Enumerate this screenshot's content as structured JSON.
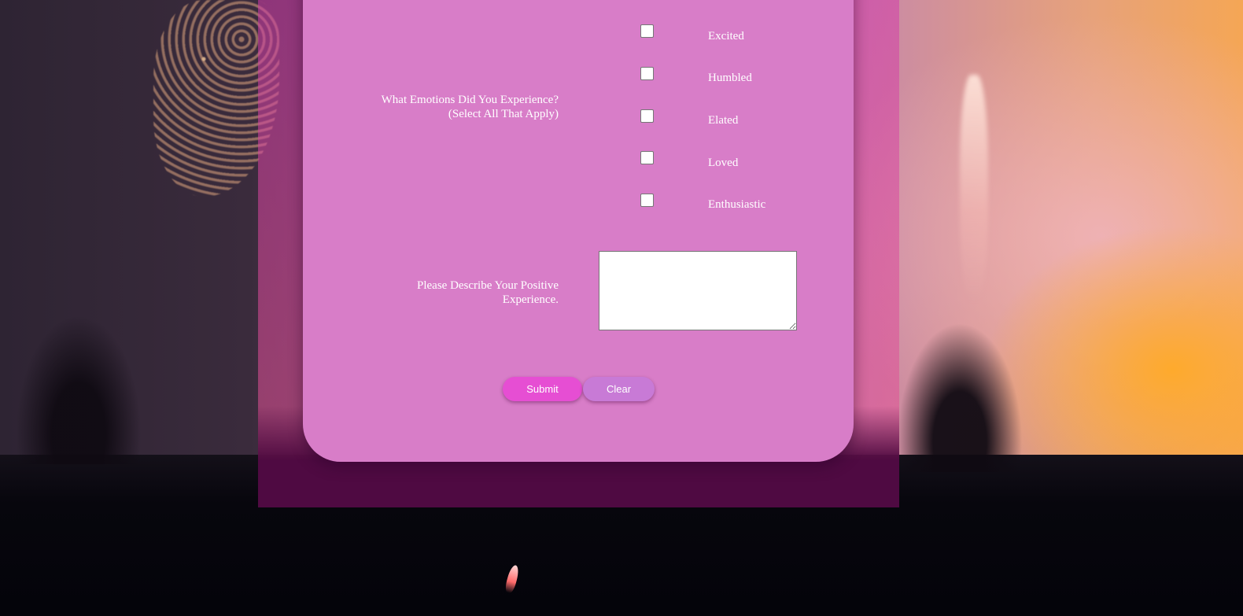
{
  "form": {
    "emotions_question": {
      "line1": "What Emotions Did You Experience?",
      "line2": "(Select All That Apply)"
    },
    "emotion_options": [
      "Excited",
      "Humbled",
      "Elated",
      "Loved",
      "Enthusiastic"
    ],
    "describe_question": {
      "line1": "Please Describe Your Positive",
      "line2": "Experience."
    },
    "describe_value": "",
    "submit_label": "Submit",
    "clear_label": "Clear"
  },
  "colors": {
    "card": "#d87dc8",
    "submit_button": "#e64ed3",
    "clear_button": "#c87ad6",
    "column_footer": "#4f0a42"
  }
}
